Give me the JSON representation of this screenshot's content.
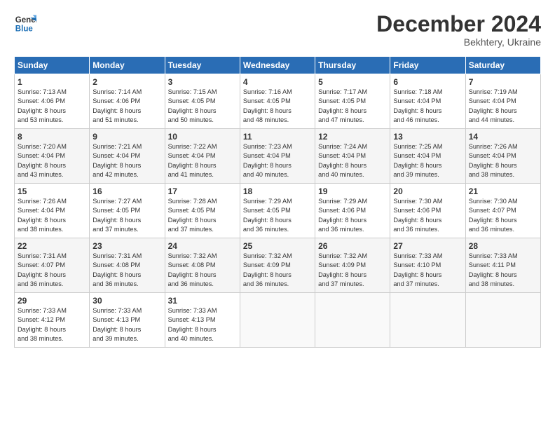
{
  "logo": {
    "line1": "General",
    "line2": "Blue"
  },
  "title": "December 2024",
  "subtitle": "Bekhtery, Ukraine",
  "weekdays": [
    "Sunday",
    "Monday",
    "Tuesday",
    "Wednesday",
    "Thursday",
    "Friday",
    "Saturday"
  ],
  "weeks": [
    [
      {
        "day": "1",
        "info": "Sunrise: 7:13 AM\nSunset: 4:06 PM\nDaylight: 8 hours\nand 53 minutes."
      },
      {
        "day": "2",
        "info": "Sunrise: 7:14 AM\nSunset: 4:06 PM\nDaylight: 8 hours\nand 51 minutes."
      },
      {
        "day": "3",
        "info": "Sunrise: 7:15 AM\nSunset: 4:05 PM\nDaylight: 8 hours\nand 50 minutes."
      },
      {
        "day": "4",
        "info": "Sunrise: 7:16 AM\nSunset: 4:05 PM\nDaylight: 8 hours\nand 48 minutes."
      },
      {
        "day": "5",
        "info": "Sunrise: 7:17 AM\nSunset: 4:05 PM\nDaylight: 8 hours\nand 47 minutes."
      },
      {
        "day": "6",
        "info": "Sunrise: 7:18 AM\nSunset: 4:04 PM\nDaylight: 8 hours\nand 46 minutes."
      },
      {
        "day": "7",
        "info": "Sunrise: 7:19 AM\nSunset: 4:04 PM\nDaylight: 8 hours\nand 44 minutes."
      }
    ],
    [
      {
        "day": "8",
        "info": "Sunrise: 7:20 AM\nSunset: 4:04 PM\nDaylight: 8 hours\nand 43 minutes."
      },
      {
        "day": "9",
        "info": "Sunrise: 7:21 AM\nSunset: 4:04 PM\nDaylight: 8 hours\nand 42 minutes."
      },
      {
        "day": "10",
        "info": "Sunrise: 7:22 AM\nSunset: 4:04 PM\nDaylight: 8 hours\nand 41 minutes."
      },
      {
        "day": "11",
        "info": "Sunrise: 7:23 AM\nSunset: 4:04 PM\nDaylight: 8 hours\nand 40 minutes."
      },
      {
        "day": "12",
        "info": "Sunrise: 7:24 AM\nSunset: 4:04 PM\nDaylight: 8 hours\nand 40 minutes."
      },
      {
        "day": "13",
        "info": "Sunrise: 7:25 AM\nSunset: 4:04 PM\nDaylight: 8 hours\nand 39 minutes."
      },
      {
        "day": "14",
        "info": "Sunrise: 7:26 AM\nSunset: 4:04 PM\nDaylight: 8 hours\nand 38 minutes."
      }
    ],
    [
      {
        "day": "15",
        "info": "Sunrise: 7:26 AM\nSunset: 4:04 PM\nDaylight: 8 hours\nand 38 minutes."
      },
      {
        "day": "16",
        "info": "Sunrise: 7:27 AM\nSunset: 4:05 PM\nDaylight: 8 hours\nand 37 minutes."
      },
      {
        "day": "17",
        "info": "Sunrise: 7:28 AM\nSunset: 4:05 PM\nDaylight: 8 hours\nand 37 minutes."
      },
      {
        "day": "18",
        "info": "Sunrise: 7:29 AM\nSunset: 4:05 PM\nDaylight: 8 hours\nand 36 minutes."
      },
      {
        "day": "19",
        "info": "Sunrise: 7:29 AM\nSunset: 4:06 PM\nDaylight: 8 hours\nand 36 minutes."
      },
      {
        "day": "20",
        "info": "Sunrise: 7:30 AM\nSunset: 4:06 PM\nDaylight: 8 hours\nand 36 minutes."
      },
      {
        "day": "21",
        "info": "Sunrise: 7:30 AM\nSunset: 4:07 PM\nDaylight: 8 hours\nand 36 minutes."
      }
    ],
    [
      {
        "day": "22",
        "info": "Sunrise: 7:31 AM\nSunset: 4:07 PM\nDaylight: 8 hours\nand 36 minutes."
      },
      {
        "day": "23",
        "info": "Sunrise: 7:31 AM\nSunset: 4:08 PM\nDaylight: 8 hours\nand 36 minutes."
      },
      {
        "day": "24",
        "info": "Sunrise: 7:32 AM\nSunset: 4:08 PM\nDaylight: 8 hours\nand 36 minutes."
      },
      {
        "day": "25",
        "info": "Sunrise: 7:32 AM\nSunset: 4:09 PM\nDaylight: 8 hours\nand 36 minutes."
      },
      {
        "day": "26",
        "info": "Sunrise: 7:32 AM\nSunset: 4:09 PM\nDaylight: 8 hours\nand 37 minutes."
      },
      {
        "day": "27",
        "info": "Sunrise: 7:33 AM\nSunset: 4:10 PM\nDaylight: 8 hours\nand 37 minutes."
      },
      {
        "day": "28",
        "info": "Sunrise: 7:33 AM\nSunset: 4:11 PM\nDaylight: 8 hours\nand 38 minutes."
      }
    ],
    [
      {
        "day": "29",
        "info": "Sunrise: 7:33 AM\nSunset: 4:12 PM\nDaylight: 8 hours\nand 38 minutes."
      },
      {
        "day": "30",
        "info": "Sunrise: 7:33 AM\nSunset: 4:13 PM\nDaylight: 8 hours\nand 39 minutes."
      },
      {
        "day": "31",
        "info": "Sunrise: 7:33 AM\nSunset: 4:13 PM\nDaylight: 8 hours\nand 40 minutes."
      },
      {
        "day": "",
        "info": ""
      },
      {
        "day": "",
        "info": ""
      },
      {
        "day": "",
        "info": ""
      },
      {
        "day": "",
        "info": ""
      }
    ]
  ]
}
